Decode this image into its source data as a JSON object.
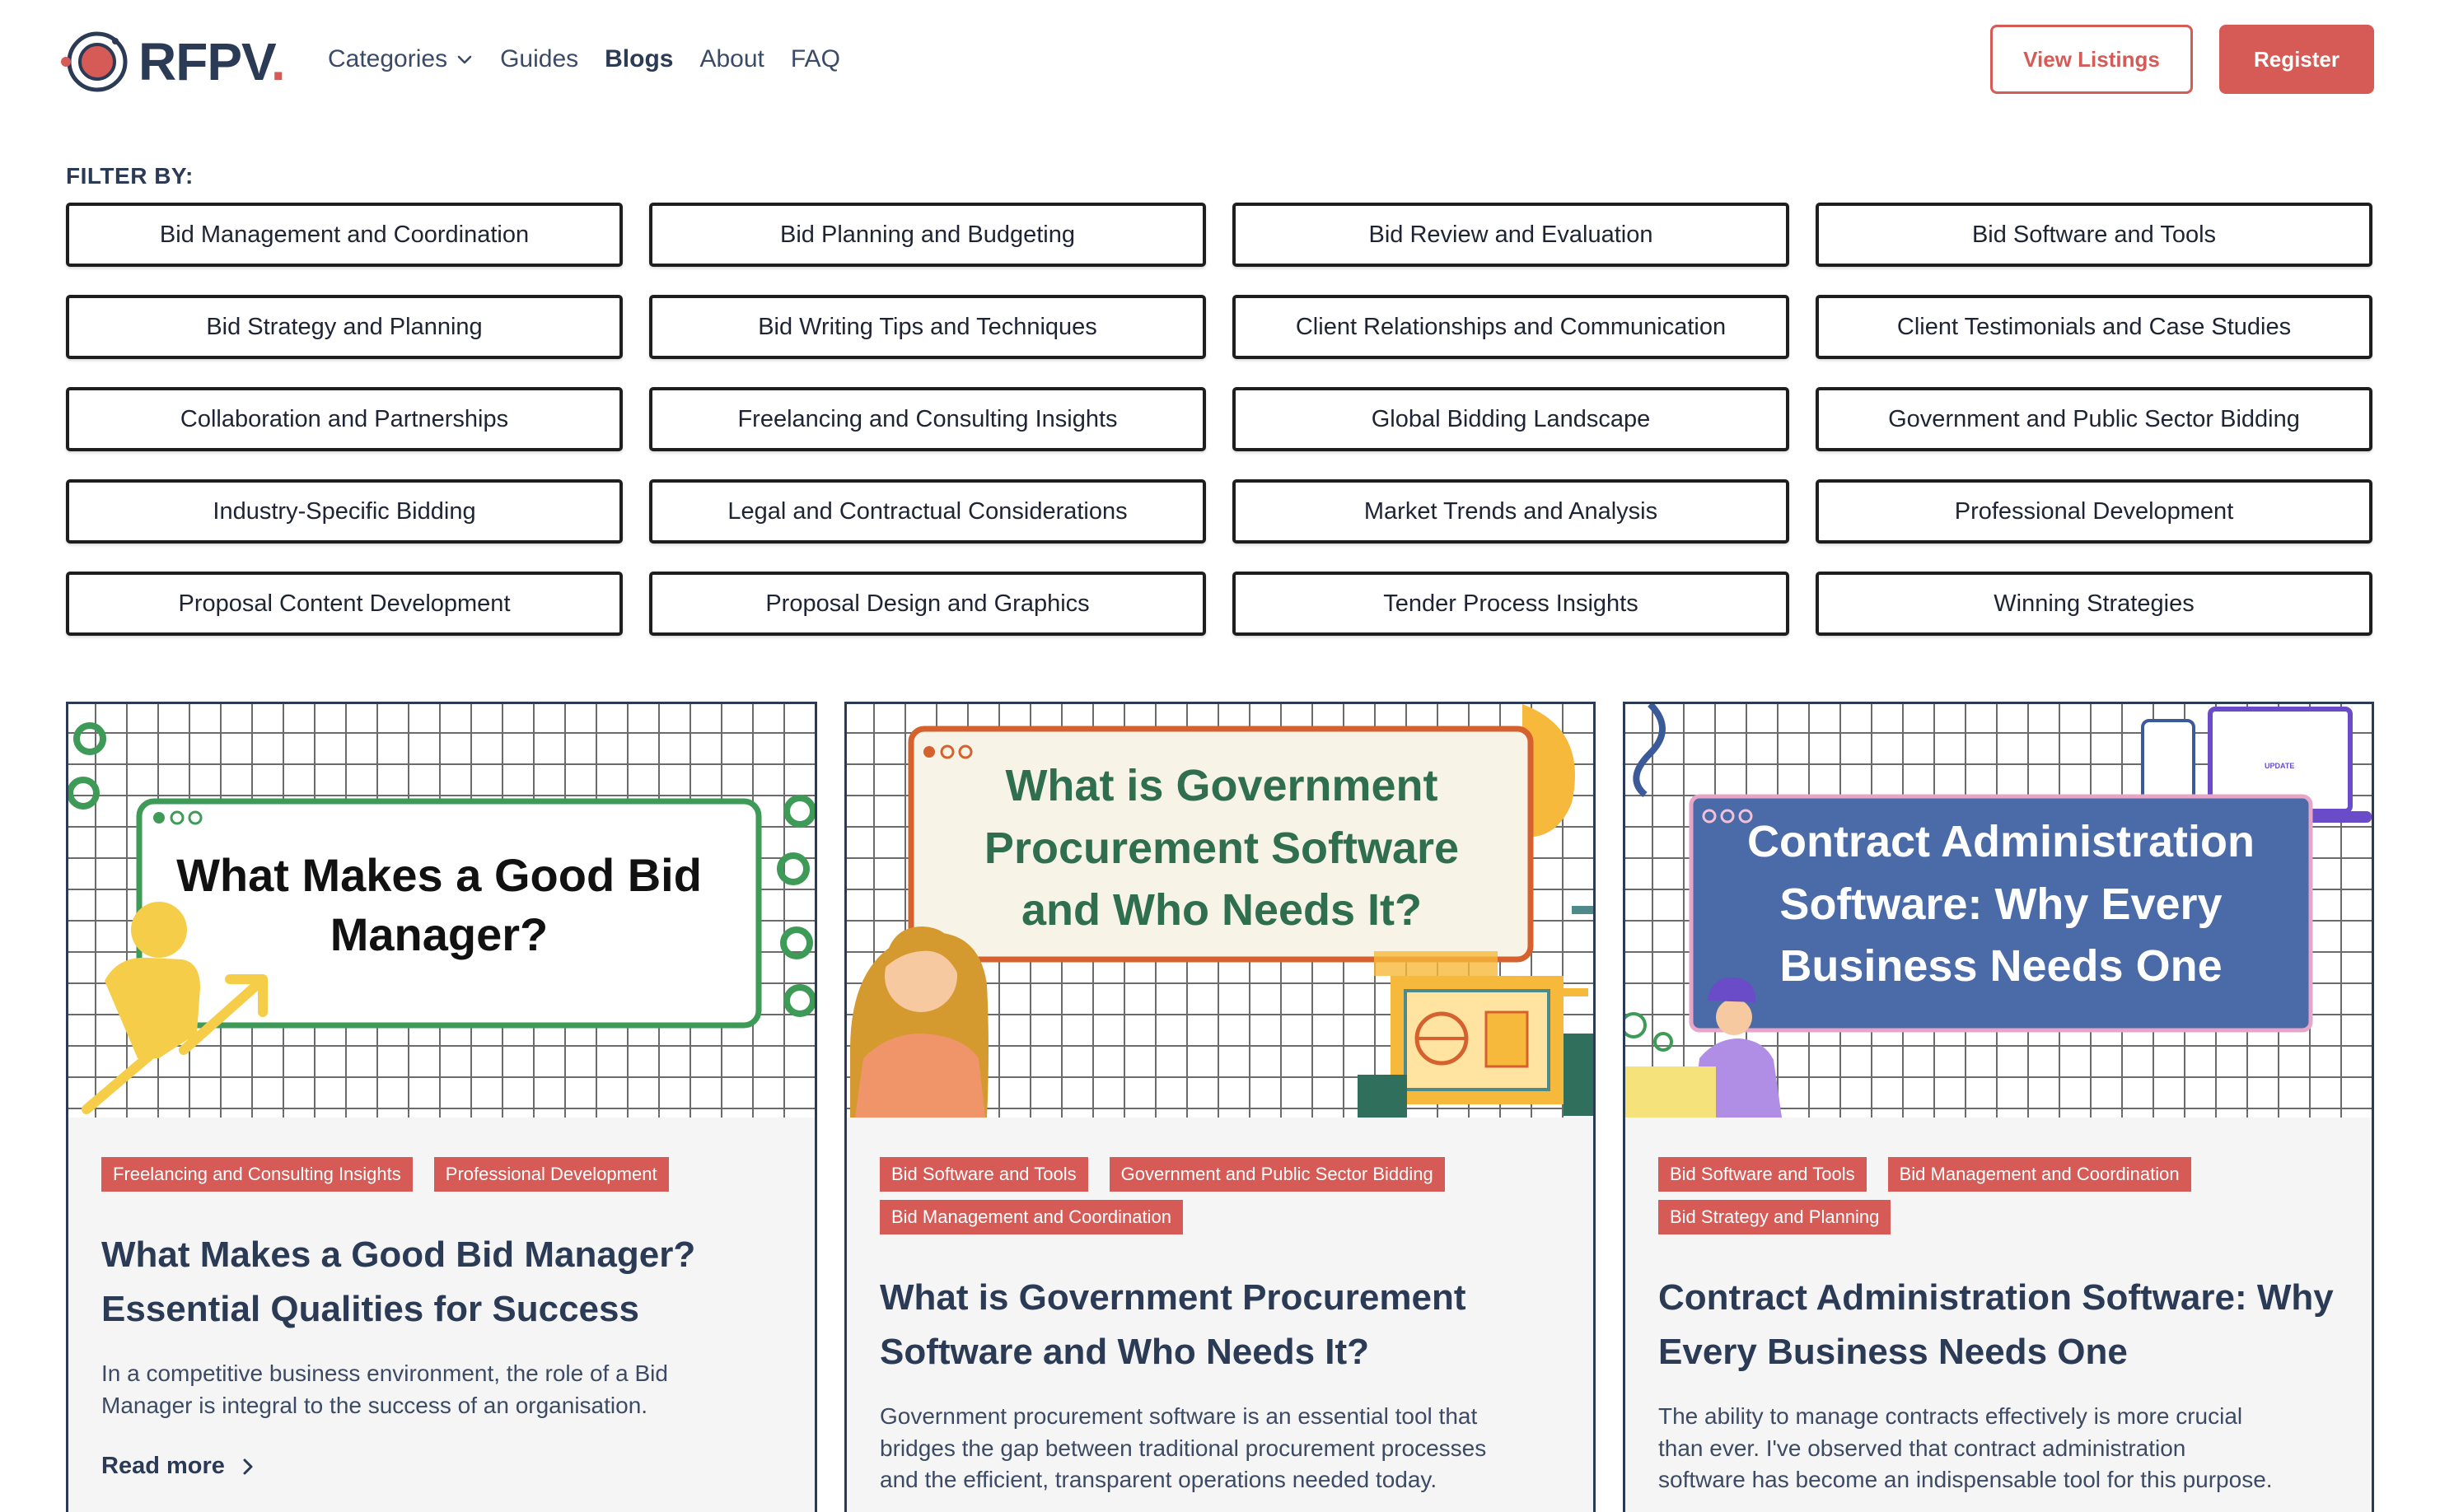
{
  "brand": {
    "name": "RFPV",
    "dot": ".",
    "accent": "#d65a55",
    "navy": "#2b3a55"
  },
  "nav": {
    "categories": "Categories",
    "guides": "Guides",
    "blogs": "Blogs",
    "about": "About",
    "faq": "FAQ"
  },
  "header_buttons": {
    "view_listings": "View Listings",
    "register": "Register"
  },
  "filter": {
    "label": "FILTER BY:",
    "items": [
      "Bid Management and Coordination",
      "Bid Planning and Budgeting",
      "Bid Review and Evaluation",
      "Bid Software and Tools",
      "Bid Strategy and Planning",
      "Bid Writing Tips and Techniques",
      "Client Relationships and Communication",
      "Client Testimonials and Case Studies",
      "Collaboration and Partnerships",
      "Freelancing and Consulting Insights",
      "Global Bidding Landscape",
      "Government and Public Sector Bidding",
      "Industry-Specific Bidding",
      "Legal and Contractual Considerations",
      "Market Trends and Analysis",
      "Professional Development",
      "Proposal Content Development",
      "Proposal Design and Graphics",
      "Tender Process Insights",
      "Winning Strategies"
    ]
  },
  "cards": [
    {
      "thumb_line1": "What Makes a Good Bid",
      "thumb_line2": "Manager?",
      "tags": [
        "Freelancing and Consulting Insights",
        "Professional Development"
      ],
      "title_line1": "What Makes a Good Bid Manager?",
      "title_line2": "Essential Qualities for Success",
      "excerpt_line1": "In a competitive business environment, the role of a Bid",
      "excerpt_line2": "Manager is integral to the success of an organisation.",
      "read_more": "Read more"
    },
    {
      "thumb_line1": "What is Government",
      "thumb_line2": "Procurement Software",
      "thumb_line3": "and Who Needs It?",
      "tags": [
        "Bid Software and Tools",
        "Government and Public Sector Bidding",
        "Bid Management and Coordination"
      ],
      "title_line1": "What is Government Procurement",
      "title_line2": "Software and Who Needs It?",
      "excerpt_line1": "Government procurement software is an essential tool that",
      "excerpt_line2": "bridges the gap between traditional procurement processes",
      "excerpt_line3": "and the efficient, transparent operations needed today."
    },
    {
      "thumb_line1": "Contract Administration",
      "thumb_line2": "Software: Why Every",
      "thumb_line3": "Business Needs One",
      "thumb_badge": "UPDATE",
      "tags": [
        "Bid Software and Tools",
        "Bid Management and Coordination",
        "Bid Strategy and Planning"
      ],
      "title_line1": "Contract Administration Software: Why",
      "title_line2": "Every Business Needs One",
      "excerpt_line1": "The ability to manage contracts effectively is more crucial",
      "excerpt_line2": "than ever. I've observed that contract administration",
      "excerpt_line3": "software has become an indispensable tool for this purpose."
    }
  ]
}
